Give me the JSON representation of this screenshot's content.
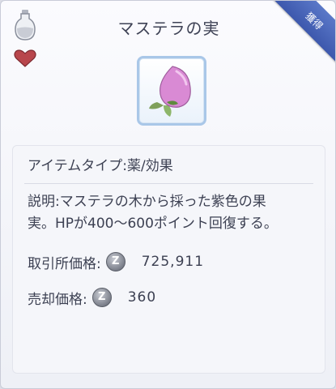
{
  "title": "マステラの実",
  "corner_badge": "獲得",
  "item": {
    "icon": "mastela-fruit-icon"
  },
  "info": {
    "type_line": "アイテムタイプ:薬/効果",
    "description_line1": "説明:マステラの木から採った紫色の果",
    "description_line2": "実。HPが400～600ポイント回復する。",
    "exchange_label": "取引所価格:",
    "exchange_value": "725,911",
    "sell_label": "売却価格:",
    "sell_value": "360"
  },
  "colors": {
    "corner": "#4a66b8",
    "frame": "#a9c7e8",
    "fruit": "#d98ad4"
  }
}
